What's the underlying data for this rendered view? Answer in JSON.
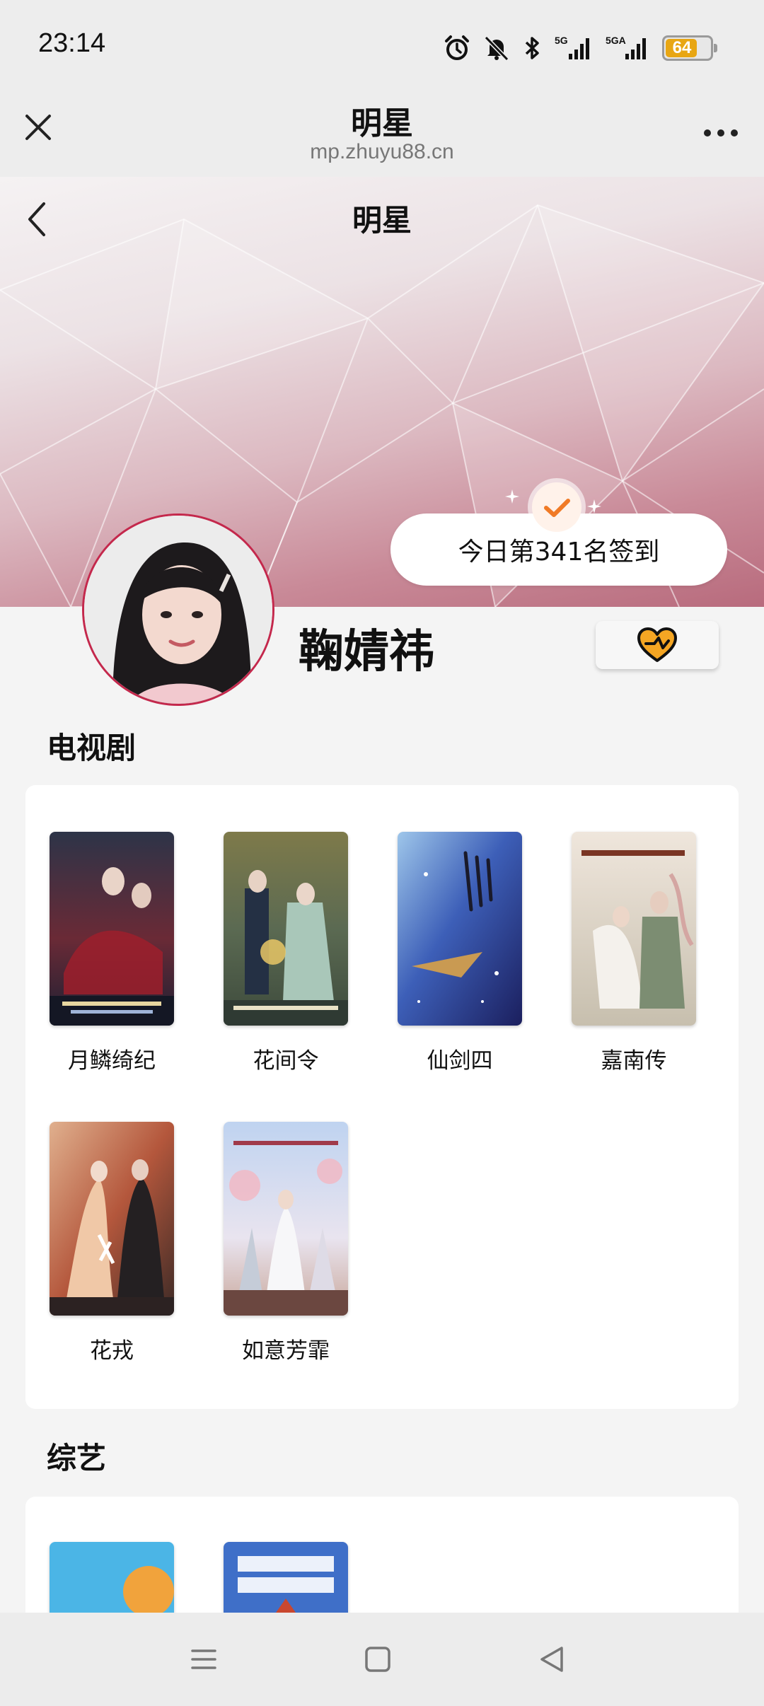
{
  "status_bar": {
    "time": "23:14",
    "battery": "64",
    "network_1": "5G",
    "network_2": "5GA",
    "battery_color": "#e8a613"
  },
  "browser": {
    "title": "明星",
    "url": "mp.zhuyu88.cn",
    "close_icon": "close-icon",
    "more_icon": "more-icon"
  },
  "hero": {
    "title": "明星",
    "checkin_text": "今日第341名签到"
  },
  "profile": {
    "name": "鞠婧祎",
    "follow_icon": "heart-icon",
    "accent_color": "#c4284c"
  },
  "sections": {
    "tv": {
      "title": "电视剧",
      "items": [
        {
          "title": "月鳞绮纪"
        },
        {
          "title": "花间令"
        },
        {
          "title": "仙剑四"
        },
        {
          "title": "嘉南传"
        },
        {
          "title": "花戎"
        },
        {
          "title": "如意芳霏"
        }
      ]
    },
    "variety": {
      "title": "综艺",
      "items": [
        {
          "title": ""
        },
        {
          "title": ""
        }
      ]
    }
  },
  "nav_bar": {
    "menu_icon": "menu-icon",
    "home_icon": "home-icon",
    "back_icon": "back-triangle-icon"
  }
}
